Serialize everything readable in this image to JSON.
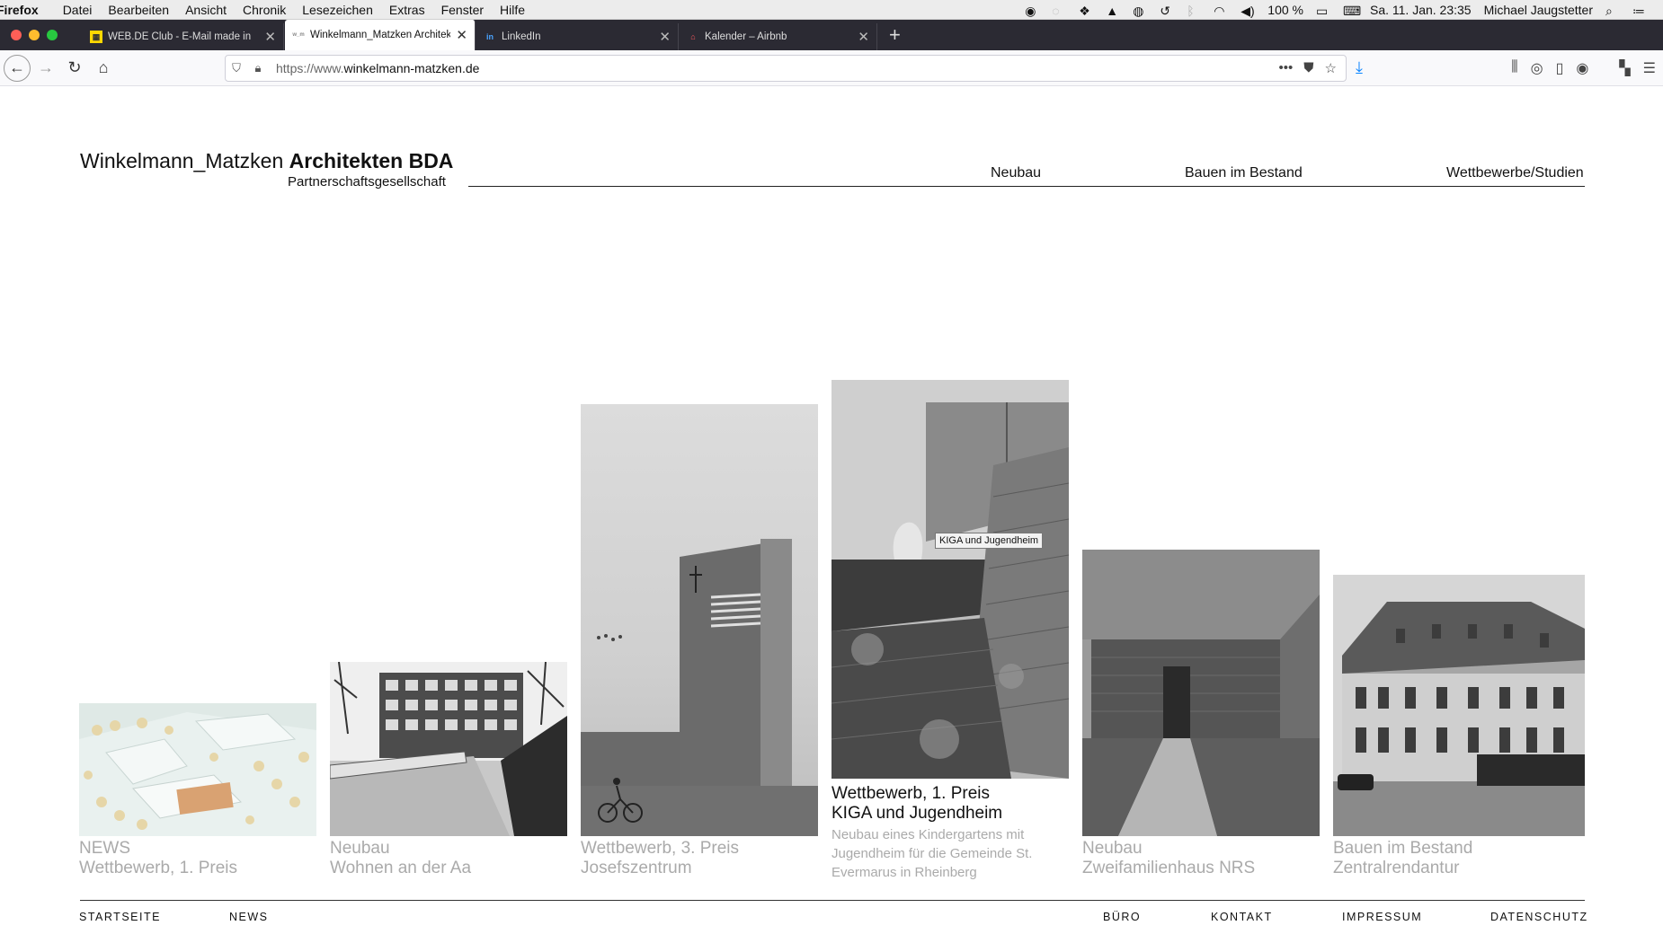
{
  "os_menubar": {
    "app_name": "Firefox",
    "menus": [
      "Datei",
      "Bearbeiten",
      "Ansicht",
      "Chronik",
      "Lesezeichen",
      "Extras",
      "Fenster",
      "Hilfe"
    ],
    "battery": "100 %",
    "clock": "Sa. 11. Jan.  23:35",
    "user": "Michael Jaugstetter"
  },
  "tabs": [
    {
      "title": "WEB.DE Club - E-Mail made in ",
      "favicon": "webde-icon"
    },
    {
      "title": "Winkelmann_Matzken Architekt",
      "favicon": "wm-icon",
      "active": true
    },
    {
      "title": "LinkedIn",
      "favicon": "linkedin-icon"
    },
    {
      "title": "Kalender – Airbnb",
      "favicon": "airbnb-icon"
    }
  ],
  "address": {
    "prefix": "https://www.",
    "domain": "winkelmann-matzken.de"
  },
  "site": {
    "brand_light": "Winkelmann_Matzken ",
    "brand_bold": "Architekten BDA",
    "brand_sub": "Partnerschaftsgesellschaft",
    "nav": [
      "Neubau",
      "Bauen im Bestand",
      "Wettbewerbe/Studien"
    ],
    "projects": [
      {
        "line1": "NEWS",
        "line2": "Wettbewerb, 1. Preis"
      },
      {
        "line1": "Neubau",
        "line2": "Wohnen an der Aa"
      },
      {
        "line1": "Wettbewerb, 3. Preis",
        "line2": "Josefszentrum"
      },
      {
        "line1": "Wettbewerb, 1. Preis",
        "line2": "KIGA und Jugendheim",
        "desc": "Neubau eines Kindergartens mit Jugendheim für die Gemeinde St. Evermarus in Rheinberg"
      },
      {
        "line1": "Neubau",
        "line2": "Zweifamilienhaus NRS"
      },
      {
        "line1": "Bauen im Bestand",
        "line2": "Zentralrendantur"
      }
    ],
    "tooltip": "KIGA und Jugendheim",
    "footer_left": [
      "STARTSEITE",
      "NEWS"
    ],
    "footer_right": [
      "BÜRO",
      "KONTAKT",
      "IMPRESSUM",
      "DATENSCHUTZ"
    ]
  }
}
